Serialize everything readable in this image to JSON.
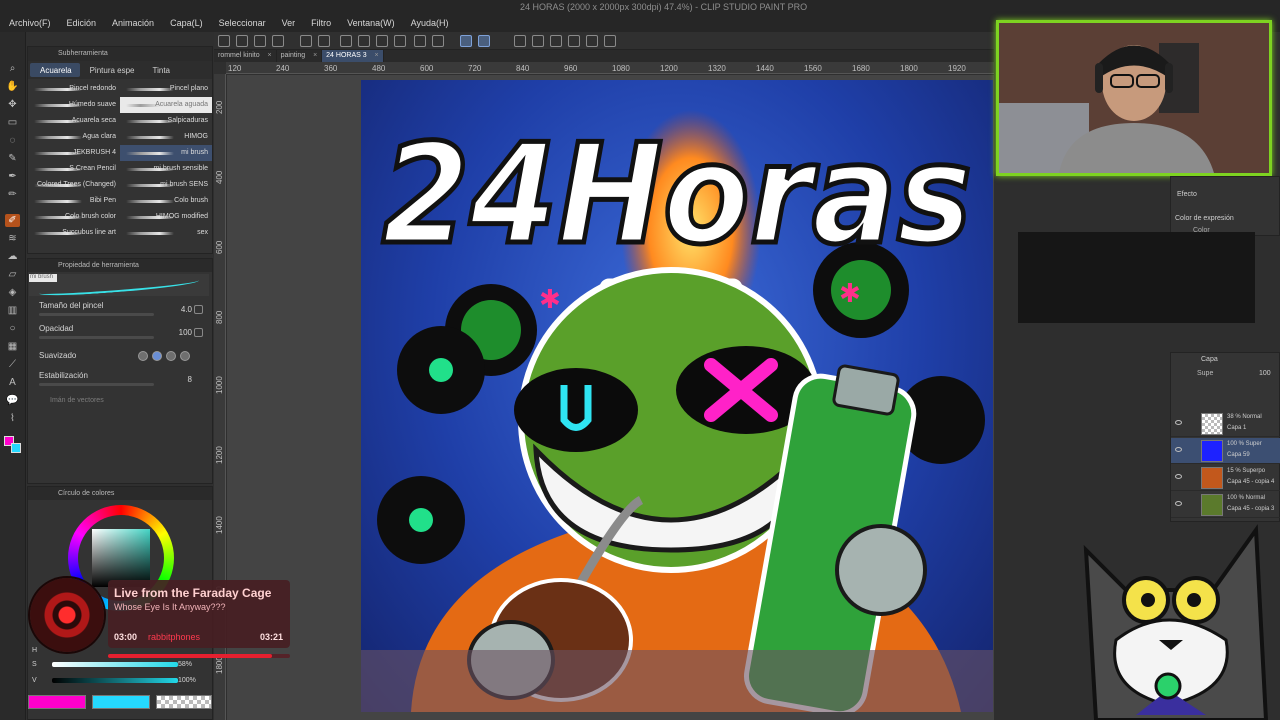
{
  "window": {
    "title": "24 HORAS (2000 x 2000px 300dpi) 47.4%) - CLIP STUDIO PAINT PRO"
  },
  "menu": [
    "Archivo(F)",
    "Edición",
    "Animación",
    "Capa(L)",
    "Seleccionar",
    "Ver",
    "Filtro",
    "Ventana(W)",
    "Ayuda(H)"
  ],
  "subtool": {
    "panel_title": "Subherramienta",
    "tabs": [
      "Acuarela",
      "Pintura espe",
      "Tinta"
    ],
    "brushes": [
      [
        "Pincel redondo",
        "Pincel plano"
      ],
      [
        "Húmedo suave",
        "Acuarela aguada"
      ],
      [
        "Acuarela seca",
        "Salpicaduras"
      ],
      [
        "Agua clara",
        "HIMOG"
      ],
      [
        "JEKBRUSH 4",
        "mi brush"
      ],
      [
        "S Crean Pencil",
        "mi brush sensible"
      ],
      [
        "Colored Trees (Changed)",
        "mi brush SENS"
      ],
      [
        "Bibi Pen",
        "Colo brush"
      ],
      [
        "Colo brush color",
        "HIMOG modified"
      ],
      [
        "Succubus line art",
        "sex"
      ]
    ]
  },
  "toolprop": {
    "panel_title": "Propiedad de herramienta",
    "brush_name": "mi brush",
    "brush_size_label": "Tamaño del pincel",
    "brush_size_value": "4.0",
    "opacity_label": "Opacidad",
    "opacity_value": "100",
    "smoothing_label": "Suavizado",
    "stabilization_label": "Estabilización",
    "stabilization_value": "8",
    "vector_label": "Imán de vectores"
  },
  "color": {
    "panel_title": "Círculo de colores",
    "h_label": "H",
    "s_label": "S",
    "v_label": "V",
    "s_value": "58%",
    "v_value": "100%",
    "main_color": "#ff00cc",
    "sub_color": "#25d9ff"
  },
  "tabs": [
    {
      "label": "rommel kinito"
    },
    {
      "label": "painting"
    },
    {
      "label": "24 HORAS 3"
    }
  ],
  "ruler": {
    "top": [
      "120",
      "240",
      "360",
      "480",
      "600",
      "720",
      "840",
      "960",
      "1080",
      "1200",
      "1320",
      "1440",
      "1560",
      "1680",
      "1800",
      "1920"
    ],
    "left": [
      "200",
      "400",
      "600",
      "800",
      "1000",
      "1200",
      "1400",
      "1600",
      "1800"
    ]
  },
  "artwork": {
    "headline": "24Horas"
  },
  "right": {
    "effect_label": "Efecto",
    "expression_label": "Color de expresión",
    "color_dropdown": "Color",
    "layer_panel_title": "Capa",
    "blend_mode": "Supe",
    "opacity_value": "100",
    "layers": [
      {
        "mode": "38 % Normal",
        "name": "Capa 1"
      },
      {
        "mode": "100 % Super",
        "name": "Capa 59"
      },
      {
        "mode": "15 % Superpo",
        "name": "Capa 45 - copia 4"
      },
      {
        "mode": "100 % Normal",
        "name": "Capa 45 - copia 3"
      }
    ]
  },
  "nowplaying": {
    "title": "Live from the Faraday Cage",
    "artist": "Whose Eye Is It Anyway???",
    "elapsed": "03:00",
    "total": "03:21",
    "scroll_text": "rabbitphones",
    "progress": 0.9
  }
}
